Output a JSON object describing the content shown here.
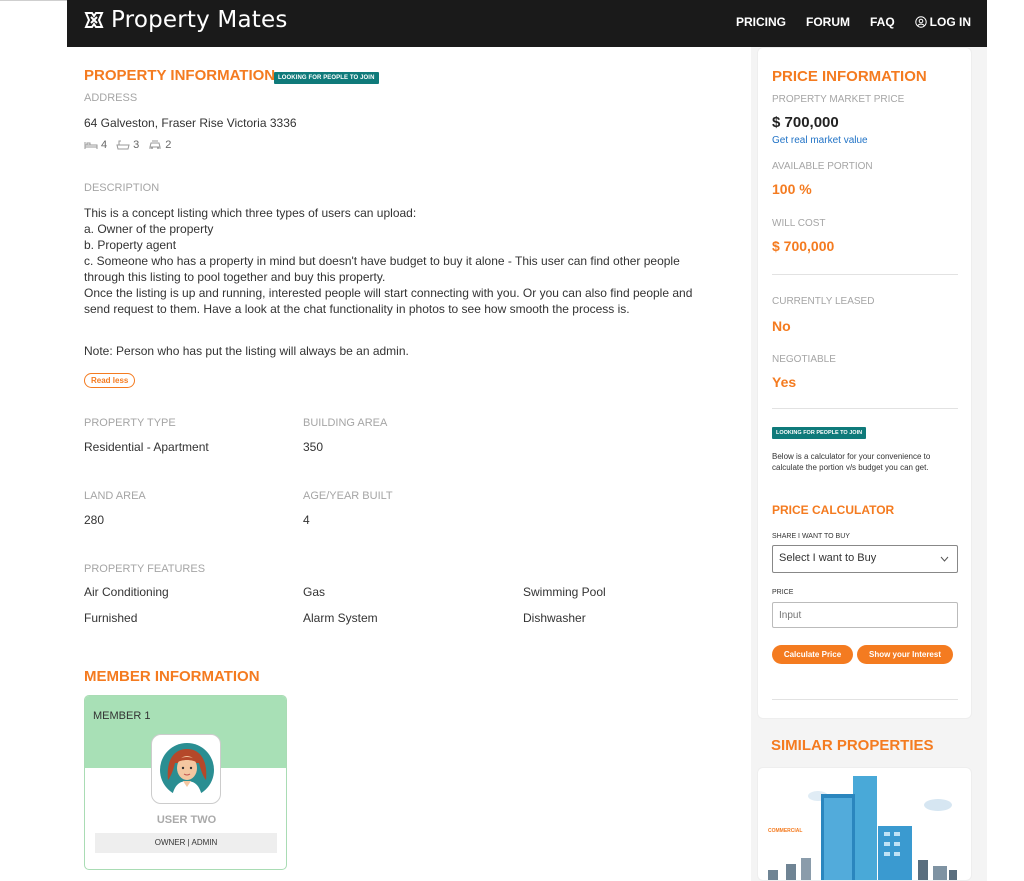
{
  "header": {
    "logo_text": "Property Mates",
    "nav": [
      {
        "label": "PRICING"
      },
      {
        "label": "FORUM"
      },
      {
        "label": "FAQ"
      },
      {
        "label": "LOG IN"
      }
    ]
  },
  "property": {
    "section_title": "PROPERTY INFORMATION",
    "badge": "LOOKING FOR PEOPLE TO JOIN",
    "address_label": "ADDRESS",
    "address": "64 Galveston, Fraser Rise Victoria 3336",
    "beds": "4",
    "baths": "3",
    "parking": "2",
    "description_label": "DESCRIPTION",
    "description_lines": [
      "This is a concept listing which three types of users can upload:",
      "a. Owner of the property",
      "b. Property agent",
      "c. Someone who has a property in mind but doesn't have budget to buy it alone - This user can find other people",
      "through this listing to pool together and buy this property.",
      "Once the listing is up and running, interested people will start connecting with you. Or you can also find people and",
      "send request to them. Have a look at the chat functionality in photos to see how smooth the process is."
    ],
    "note": "Note: Person who has put the listing will always be an admin.",
    "read_less": "Read less",
    "property_type_label": "PROPERTY TYPE",
    "property_type": "Residential - Apartment",
    "building_area_label": "BUILDING AREA",
    "building_area": "350",
    "land_area_label": "LAND AREA",
    "land_area": "280",
    "age_label": "AGE/YEAR BUILT",
    "age": "4",
    "features_label": "PROPERTY FEATURES",
    "features": [
      "Air Conditioning",
      "Gas",
      "Swimming Pool",
      "Furnished",
      "Alarm System",
      "Dishwasher"
    ]
  },
  "members": {
    "section_title": "MEMBER INFORMATION",
    "items": [
      {
        "label": "MEMBER 1",
        "name": "USER TWO",
        "role": "OWNER | ADMIN"
      }
    ]
  },
  "price": {
    "section_title": "PRICE INFORMATION",
    "market_label": "PROPERTY MARKET PRICE",
    "market_value": "$ 700,000",
    "real_value_link": "Get real market value",
    "portion_label": "AVAILABLE PORTION",
    "portion_value": "100 %",
    "cost_label": "WILL COST",
    "cost_value": "$ 700,000",
    "leased_label": "CURRENTLY LEASED",
    "leased_value": "No",
    "negotiable_label": "NEGOTIABLE",
    "negotiable_value": "Yes",
    "badge": "LOOKING FOR PEOPLE TO JOIN",
    "calc_intro": "Below is a calculator for your convenience to calculate the portion v/s budget you can get.",
    "calc_title": "PRICE CALCULATOR",
    "share_label": "SHARE I WANT TO BUY",
    "share_select": "Select I want to Buy",
    "price_label": "PRICE",
    "price_placeholder": "Input",
    "calc_button": "Calculate Price",
    "interest_button": "Show your Interest"
  },
  "similar": {
    "title": "SIMILAR PROPERTIES",
    "card_tag": "COMMERCIAL"
  },
  "colors": {
    "accent": "#f47b20",
    "badge": "#0f7a7a",
    "header_bg": "#1a1a1a",
    "link": "#2173c6"
  }
}
